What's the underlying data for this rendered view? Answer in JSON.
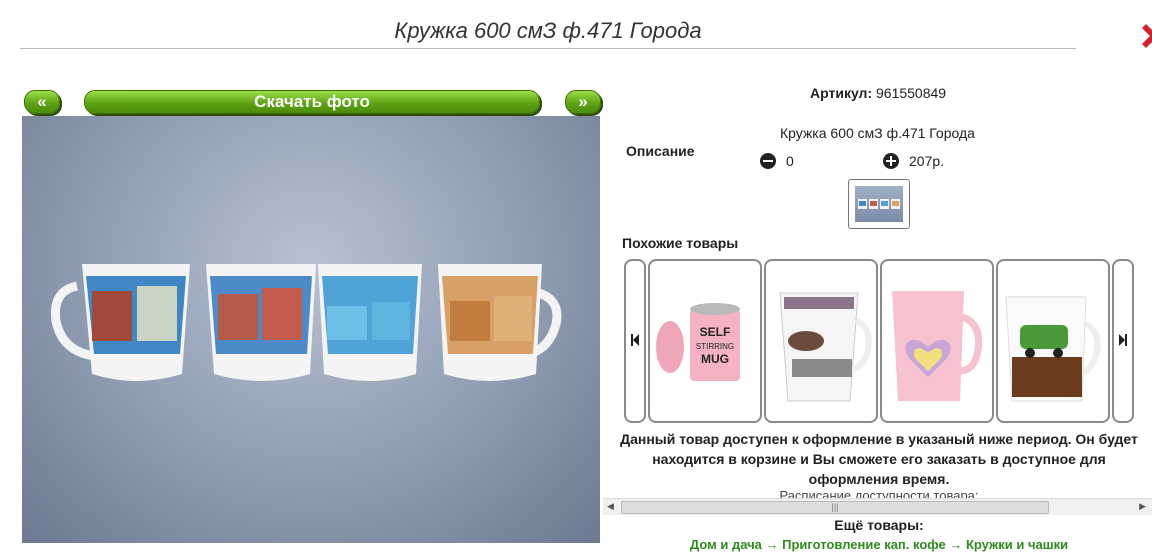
{
  "page": {
    "title": "Кружка 600 смЗ ф.471 Города"
  },
  "gallery": {
    "prev_label": "«",
    "download_label": "Скачать фото",
    "next_label": "»"
  },
  "product": {
    "article_label": "Артикул:",
    "article_value": "961550849",
    "description_label": "Описание",
    "description_text": "Кружка 600 смЗ ф.471 Города",
    "quantity": "0",
    "price": "207р."
  },
  "similar": {
    "heading": "Похожие товары",
    "items": [
      {
        "icon": "self-stirring-mug"
      },
      {
        "icon": "white-mug-with-print"
      },
      {
        "icon": "pink-heart-mug"
      },
      {
        "icon": "retro-car-mug"
      }
    ]
  },
  "availability": {
    "notice": "Данный товар доступен к оформление в указаный ниже период. Он будет находится в корзине и Вы сможете его заказать в доступное для оформления время.",
    "schedule_label": "Расписание доступности товара:"
  },
  "more": {
    "heading": "Ещё товары:",
    "links": "Дом и дача → Приготовление кап. кофе → Кружки и чашки"
  },
  "colors": {
    "accent_green": "#5ea414",
    "link_green": "#2e8b1e",
    "close_red": "#d2202f"
  }
}
